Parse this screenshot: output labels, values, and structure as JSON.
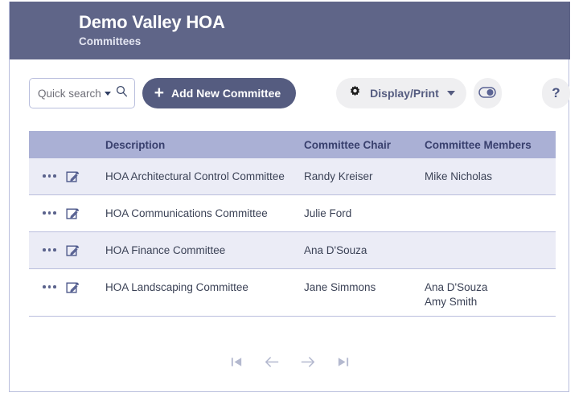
{
  "header": {
    "title": "Demo Valley HOA",
    "subtitle": "Committees"
  },
  "toolbar": {
    "search_placeholder": "Quick search",
    "search_value": "",
    "search_caret_icon": "chevron-down-icon",
    "search_icon": "search-icon",
    "add_button_label": "Add New Committee",
    "add_button_icon": "plus-icon",
    "display_print_label": "Display/Print",
    "display_print_icon": "gear-icon",
    "display_print_caret_icon": "chevron-down-icon",
    "toggle_icon": "toggle-switch-icon",
    "help_label": "?",
    "help_icon": "question-mark-icon"
  },
  "table": {
    "columns": [
      {
        "key": "actions",
        "label": ""
      },
      {
        "key": "description",
        "label": "Description"
      },
      {
        "key": "chair",
        "label": "Committee Chair"
      },
      {
        "key": "members",
        "label": "Committee Members"
      }
    ],
    "rows": [
      {
        "description": "HOA Architectural Control Committee",
        "chair": "Randy Kreiser",
        "members": "Mike Nicholas"
      },
      {
        "description": "HOA Communications Committee",
        "chair": "Julie Ford",
        "members": ""
      },
      {
        "description": "HOA Finance Committee",
        "chair": "Ana D'Souza",
        "members": ""
      },
      {
        "description": "HOA Landscaping Committee",
        "chair": "Jane Simmons",
        "members": "Ana D'Souza\nAmy Smith"
      }
    ],
    "row_action_icons": [
      "more-options-icon",
      "edit-icon"
    ]
  },
  "pagination": {
    "first_icon": "first-page-icon",
    "previous_icon": "arrow-left-icon",
    "next_icon": "arrow-right-icon",
    "last_icon": "last-page-icon"
  },
  "colors": {
    "header_bg": "#5f6588",
    "table_header_bg": "#aab0d5",
    "row_stripe_bg": "#ebecf6",
    "accent": "#555c80",
    "border": "#b9bedd"
  }
}
